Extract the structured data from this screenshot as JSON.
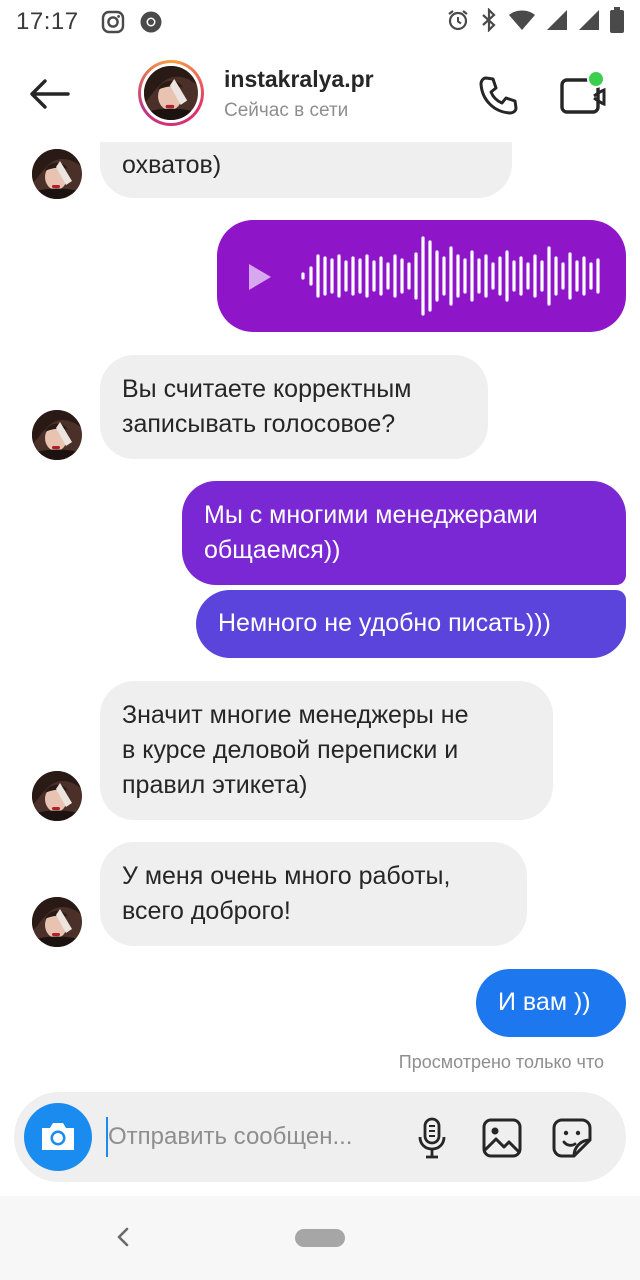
{
  "status_bar": {
    "time": "17:17",
    "left_icons": [
      "instagram-icon",
      "chrome-icon"
    ],
    "right_icons": [
      "alarm-icon",
      "bluetooth-icon",
      "wifi-icon",
      "signal-icon",
      "signal-icon",
      "battery-icon"
    ]
  },
  "header": {
    "username": "instakralya.pr",
    "status": "Сейчас в сети",
    "online_dot_color": "#3ccf4e"
  },
  "messages": [
    {
      "from": "them",
      "text": "охватов)"
    },
    {
      "from": "me",
      "type": "voice",
      "icon": "play-icon"
    },
    {
      "from": "them",
      "lines": [
        "Вы считаете корректным",
        "записывать голосовое?"
      ]
    },
    {
      "from": "me",
      "lines": [
        "Мы с многими менеджерами",
        "общаемся))"
      ]
    },
    {
      "from": "me",
      "text": "Немного не удобно писать)))"
    },
    {
      "from": "them",
      "lines": [
        "Значит многие менеджеры не",
        "в курсе деловой переписки и",
        "правил этикета)"
      ]
    },
    {
      "from": "them",
      "lines": [
        "У меня очень много работы,",
        "всего доброго!"
      ]
    },
    {
      "from": "me",
      "text": "И вам ))"
    }
  ],
  "seen_status": "Просмотрено только что",
  "composer": {
    "placeholder": "Отправить сообщен...",
    "icons": [
      "camera-icon",
      "microphone-icon",
      "gallery-icon",
      "sticker-icon"
    ]
  },
  "colors": {
    "voice_bubble": "#8e16c8",
    "gradient_top": "#7a28d4",
    "gradient_mid": "#5a44dc",
    "blue_bubble": "#1d77ee",
    "camera_button": "#1a8cf0",
    "incoming_bubble": "#efefef"
  }
}
